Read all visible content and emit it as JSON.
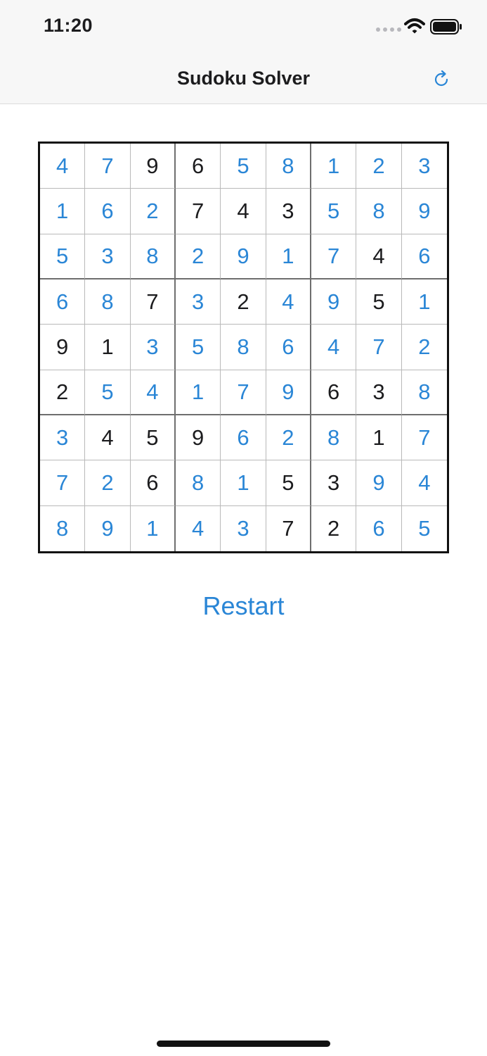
{
  "status": {
    "time": "11:20"
  },
  "nav": {
    "title": "Sudoku Solver",
    "refresh_icon": "refresh-icon"
  },
  "colors": {
    "accent": "#2a86d6",
    "given": "#1c1c1e",
    "grid_line": "#b9b9b9",
    "box_line": "#6e6e6e"
  },
  "board": {
    "rows": [
      [
        "4",
        "7",
        "9",
        "6",
        "5",
        "8",
        "1",
        "2",
        "3"
      ],
      [
        "1",
        "6",
        "2",
        "7",
        "4",
        "3",
        "5",
        "8",
        "9"
      ],
      [
        "5",
        "3",
        "8",
        "2",
        "9",
        "1",
        "7",
        "4",
        "6"
      ],
      [
        "6",
        "8",
        "7",
        "3",
        "2",
        "4",
        "9",
        "5",
        "1"
      ],
      [
        "9",
        "1",
        "3",
        "5",
        "8",
        "6",
        "4",
        "7",
        "2"
      ],
      [
        "2",
        "5",
        "4",
        "1",
        "7",
        "9",
        "6",
        "3",
        "8"
      ],
      [
        "3",
        "4",
        "5",
        "9",
        "6",
        "2",
        "8",
        "1",
        "7"
      ],
      [
        "7",
        "2",
        "6",
        "8",
        "1",
        "5",
        "3",
        "9",
        "4"
      ],
      [
        "8",
        "9",
        "1",
        "4",
        "3",
        "7",
        "2",
        "6",
        "5"
      ]
    ],
    "given": [
      [
        0,
        0,
        1,
        1,
        0,
        0,
        0,
        0,
        0
      ],
      [
        0,
        0,
        0,
        1,
        1,
        1,
        0,
        0,
        0
      ],
      [
        0,
        0,
        0,
        0,
        0,
        0,
        0,
        1,
        0
      ],
      [
        0,
        0,
        1,
        0,
        1,
        0,
        0,
        1,
        0
      ],
      [
        1,
        1,
        0,
        0,
        0,
        0,
        0,
        0,
        0
      ],
      [
        1,
        0,
        0,
        0,
        0,
        0,
        1,
        1,
        0
      ],
      [
        0,
        1,
        1,
        1,
        0,
        0,
        0,
        1,
        0
      ],
      [
        0,
        0,
        1,
        0,
        0,
        1,
        1,
        0,
        0
      ],
      [
        0,
        0,
        0,
        0,
        0,
        1,
        1,
        0,
        0
      ]
    ]
  },
  "actions": {
    "restart_label": "Restart"
  }
}
